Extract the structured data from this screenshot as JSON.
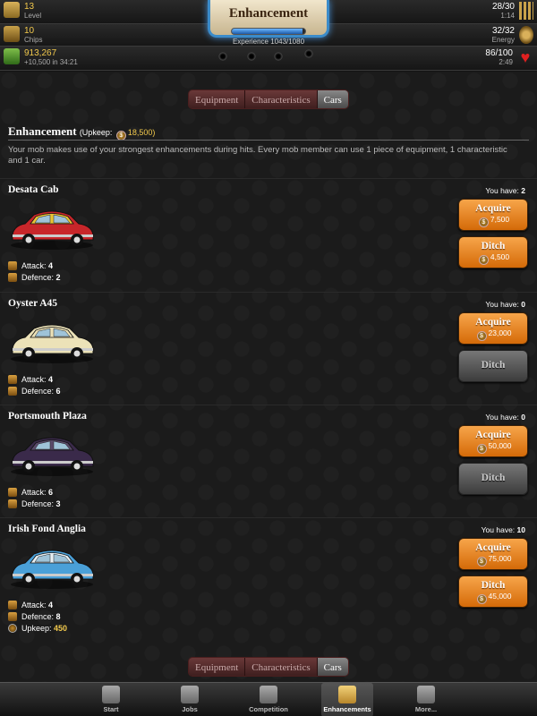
{
  "hud": {
    "level": {
      "value": "13",
      "label": "Level"
    },
    "chips": {
      "value": "10",
      "label": "Chips"
    },
    "cash": {
      "value": "913,267",
      "label": "+10,500 in 34:21"
    },
    "ammo": {
      "value": "28/30",
      "label": "1:14"
    },
    "energy": {
      "value": "32/32",
      "label": "Energy"
    },
    "health": {
      "value": "86/100",
      "label": "2:49"
    },
    "title": "Enhancement",
    "experience_text": "Experience 1043/1080",
    "experience_progress": 0.966
  },
  "tabs": [
    "Equipment",
    "Characteristics",
    "Cars"
  ],
  "active_tab": "Cars",
  "section": {
    "title": "Enhancement",
    "upkeep_prefix": "(Upkeep:",
    "upkeep_amount": "18,500)",
    "description": "Your mob makes use of your strongest enhancements during hits. Every mob member can use 1 piece of equipment, 1 characteristic and 1 car."
  },
  "labels": {
    "you_have": "You have:",
    "attack": "Attack:",
    "defence": "Defence:",
    "upkeep": "Upkeep:",
    "acquire": "Acquire",
    "ditch": "Ditch"
  },
  "cars": [
    {
      "name": "Desata Cab",
      "owned": "2",
      "attack": "4",
      "defence": "2",
      "acquire_price": "7,500",
      "ditch_price": "4,500",
      "colors": {
        "body": "#c8262a",
        "top": "#e8c534"
      }
    },
    {
      "name": "Oyster A45",
      "owned": "0",
      "attack": "4",
      "defence": "6",
      "acquire_price": "23,000",
      "ditch_price": "",
      "colors": {
        "body": "#ece2b8",
        "top": "#ece2b8"
      }
    },
    {
      "name": "Portsmouth Plaza",
      "owned": "0",
      "attack": "6",
      "defence": "3",
      "acquire_price": "50,000",
      "ditch_price": "",
      "colors": {
        "body": "#3a2a4a",
        "top": "#5a4a6a"
      }
    },
    {
      "name": "Irish Fond Anglia",
      "owned": "10",
      "attack": "4",
      "defence": "8",
      "upkeep": "450",
      "acquire_price": "75,000",
      "ditch_price": "45,000",
      "colors": {
        "body": "#4aa0d8",
        "top": "#e8f0f4"
      }
    }
  ],
  "nav": [
    {
      "label": "Start",
      "icon": "home-icon"
    },
    {
      "label": "Jobs",
      "icon": "jobs-icon"
    },
    {
      "label": "Competition",
      "icon": "competition-icon"
    },
    {
      "label": "Enhancements",
      "icon": "enhancements-icon"
    },
    {
      "label": "More...",
      "icon": "more-icon"
    }
  ],
  "active_nav": "Enhancements"
}
